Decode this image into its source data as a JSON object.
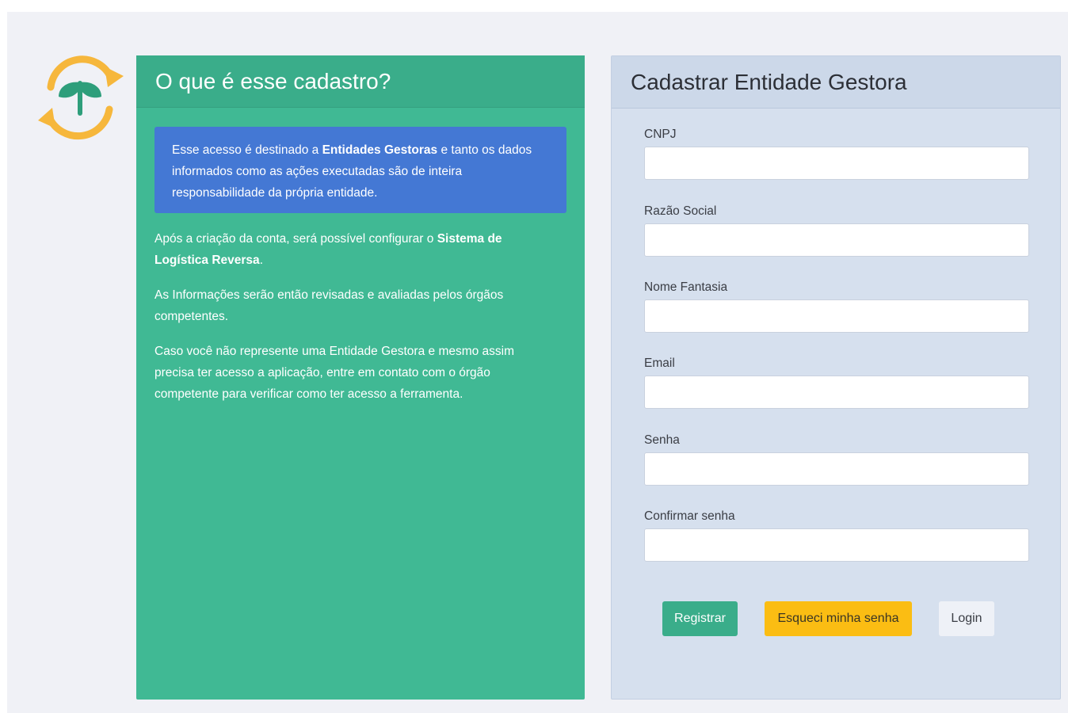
{
  "colors": {
    "page_bg": "#f0f1f6",
    "info_panel": "#40b994",
    "notice_bg": "#4478d4",
    "form_panel": "#d6e0ee",
    "register_button": "#3aad8a",
    "forgot_button": "#fbbd13",
    "login_button": "#eef1f7",
    "logo_ring": "#f6b73c",
    "logo_leaf": "#2e9e7b"
  },
  "logo": {
    "icon": "recycle-sprout-icon"
  },
  "info": {
    "title": "O que é esse cadastro?",
    "notice": {
      "part1": "Esse acesso é destinado a ",
      "bold": "Entidades Gestoras",
      "part2": " e tanto os dados informados como as ações executadas são de inteira responsabilidade da própria entidade."
    },
    "paragraph1": {
      "part1": "Após a criação da conta, será possível configurar o ",
      "bold": "Sistema de Logística Reversa",
      "part2": "."
    },
    "paragraph2": "As Informações serão então revisadas e avaliadas pelos órgãos competentes.",
    "paragraph3": "Caso você não represente uma Entidade Gestora e mesmo assim precisa ter acesso a aplicação, entre em contato com o órgão competente para verificar como ter acesso a ferramenta."
  },
  "form": {
    "title": "Cadastrar Entidade Gestora",
    "fields": [
      {
        "label": "CNPJ",
        "value": ""
      },
      {
        "label": "Razão Social",
        "value": ""
      },
      {
        "label": "Nome Fantasia",
        "value": ""
      },
      {
        "label": "Email",
        "value": ""
      },
      {
        "label": "Senha",
        "value": ""
      },
      {
        "label": "Confirmar senha",
        "value": ""
      }
    ],
    "buttons": {
      "register": "Registrar",
      "forgot": "Esqueci minha senha",
      "login": "Login"
    }
  }
}
